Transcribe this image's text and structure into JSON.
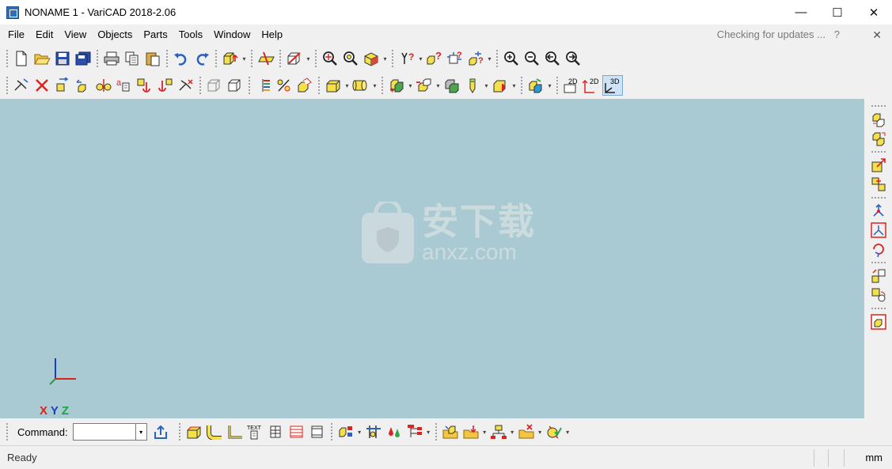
{
  "window": {
    "title": "NONAME 1 - VariCAD 2018-2.06",
    "controls": {
      "minimize": "—",
      "maximize": "☐",
      "close": "✕"
    }
  },
  "menubar": {
    "items": [
      "File",
      "Edit",
      "View",
      "Objects",
      "Parts",
      "Tools",
      "Window",
      "Help"
    ],
    "update_status": "Checking for updates ...",
    "help_icon": "?",
    "close_icon": "✕"
  },
  "toolbar": {
    "view_2d_label": "2D",
    "view_2d3d_label": "2D",
    "view_3d_label": "3D",
    "text_label": "TEXT"
  },
  "canvas": {
    "background": "#a9cad2",
    "axes": {
      "x": "X",
      "y": "Y",
      "z": "Z"
    },
    "watermark": {
      "title": "安下载",
      "url": "anxz.com"
    }
  },
  "command_bar": {
    "label": "Command:",
    "input_value": ""
  },
  "statusbar": {
    "status": "Ready",
    "units": "mm"
  }
}
